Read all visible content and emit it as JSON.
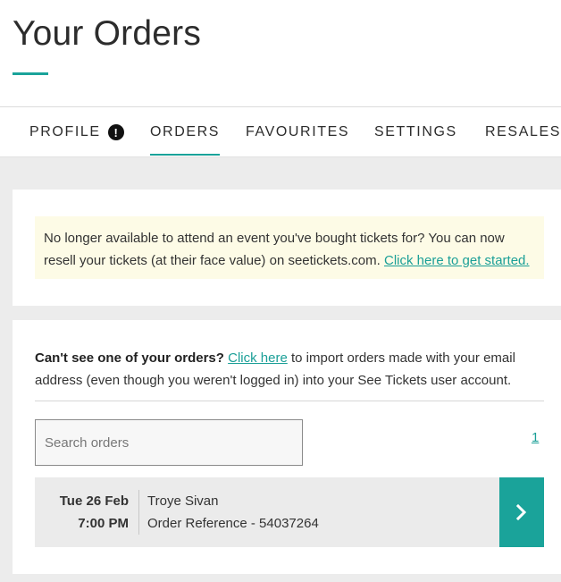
{
  "header": {
    "title": "Your Orders"
  },
  "tabs": [
    {
      "label": "PROFILE",
      "alert": "!"
    },
    {
      "label": "ORDERS"
    },
    {
      "label": "FAVOURITES"
    },
    {
      "label": "SETTINGS"
    },
    {
      "label": "RESALES"
    }
  ],
  "active_tab": "ORDERS",
  "resale_notice": {
    "text": "No longer available to attend an event you've bought tickets for? You can now resell your tickets (at their face value) on seetickets.com. ",
    "link": "Click here to get started."
  },
  "import_notice": {
    "bold": "Can't see one of your orders?",
    "link": "Click here",
    "text": " to import orders made with your email address (even though you weren't logged in) into your See Tickets user account."
  },
  "search": {
    "placeholder": "Search orders",
    "value": ""
  },
  "pagination": {
    "current": "1"
  },
  "orders": [
    {
      "date": "Tue 26 Feb",
      "time": "7:00 PM",
      "artist": "Troye Sivan",
      "reference": "Order Reference - 54037264"
    }
  ],
  "colors": {
    "accent": "#1aa39a",
    "notice_bg": "#fdfbe6",
    "page_bg": "#ececec"
  },
  "icons": {
    "profile_alert": "exclamation-circle-icon",
    "order_open": "chevron-right-icon"
  }
}
